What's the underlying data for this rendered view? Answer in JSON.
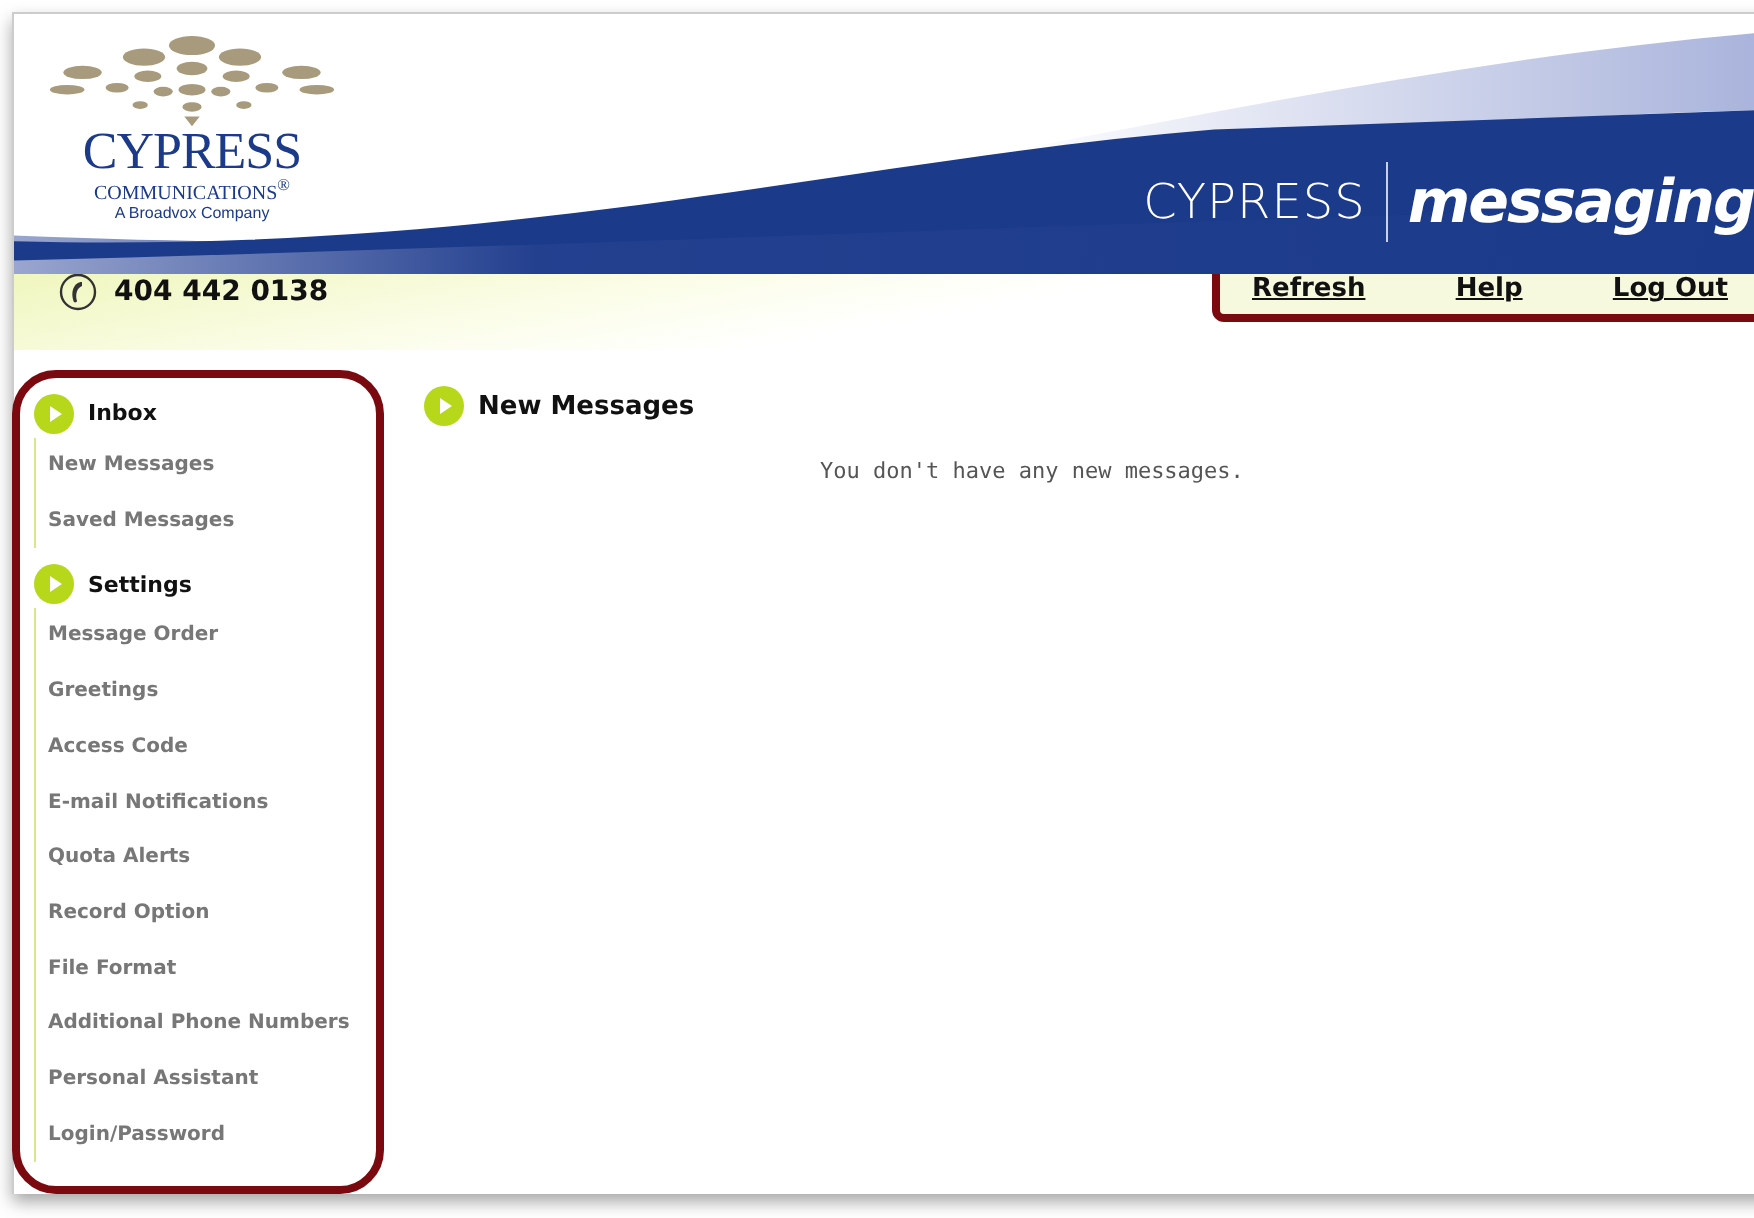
{
  "header": {
    "logo": {
      "name": "CYPRESS",
      "line_2": "COMMUNICATIONS$^{®}$",
      "line_3": "A Broadvox Company"
    },
    "brand": {
      "name": "CYPRESS",
      "product": "messaging"
    }
  },
  "phone": "404 442 0138",
  "top_links": [
    "Refresh",
    "Help",
    "Log Out"
  ],
  "sidebar": {
    "sections": [
      {
        "title": "Inbox",
        "items": [
          "New Messages",
          "Saved Messages"
        ]
      },
      {
        "title": "Settings",
        "items": [
          "Message Order",
          "Greetings",
          "Access Code",
          "E-mail Notifications",
          "Quota Alerts",
          "Record Option",
          "File Format",
          "Additional Phone Numbers",
          "Personal Assistant",
          "Login/Password"
        ]
      }
    ]
  },
  "content": {
    "title": "New Messages",
    "message": "You don't have any new messages."
  }
}
